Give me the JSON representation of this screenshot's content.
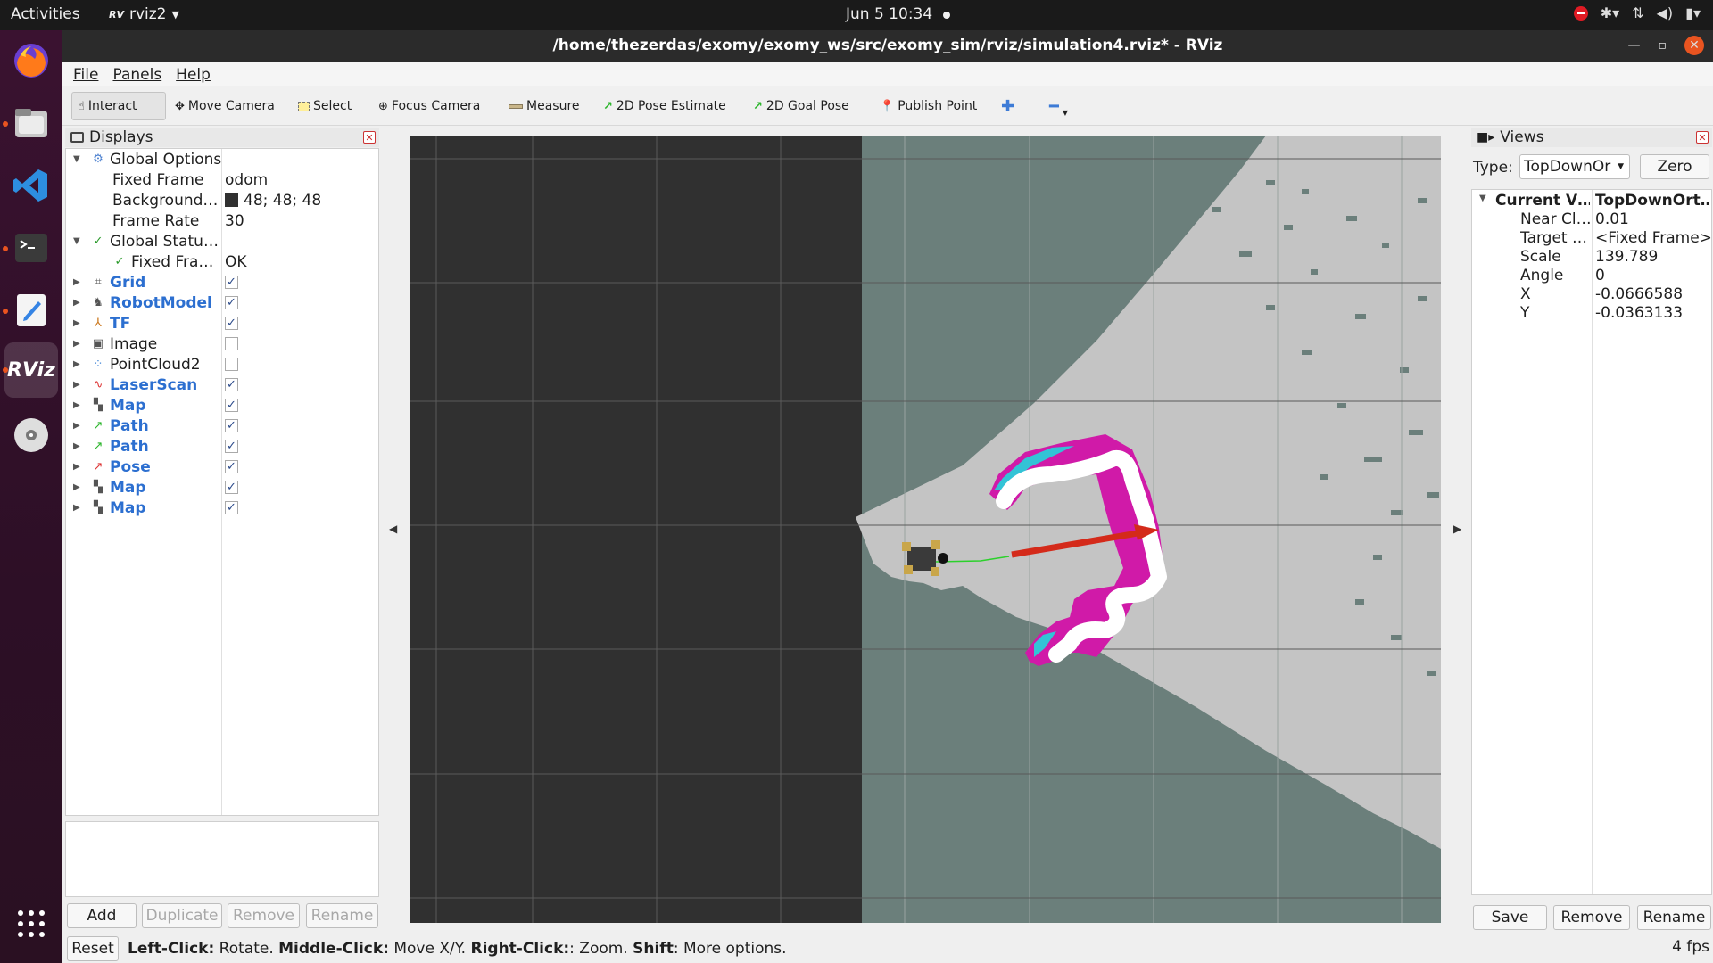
{
  "topbar": {
    "activities": "Activities",
    "app_name": "rviz2",
    "app_badge": "RV",
    "clock": "Jun 5  10:34"
  },
  "dock": {
    "items": [
      "firefox-icon",
      "files-icon",
      "vscode-icon",
      "terminal-icon",
      "text-editor-icon",
      "rviz-icon",
      "disc-icon",
      "app-grid-icon"
    ],
    "rviz_label": "RViz"
  },
  "window": {
    "title": "/home/thezerdas/exomy/exomy_ws/src/exomy_sim/rviz/simulation4.rviz* - RViz"
  },
  "menubar": [
    "File",
    "Panels",
    "Help"
  ],
  "toolbar": {
    "interact": "Interact",
    "move_camera": "Move Camera",
    "select": "Select",
    "focus_camera": "Focus Camera",
    "measure": "Measure",
    "pose_estimate": "2D Pose Estimate",
    "goal_pose": "2D Goal Pose",
    "publish_point": "Publish Point"
  },
  "displays": {
    "title": "Displays",
    "global_options": "Global Options",
    "fixed_frame_label": "Fixed Frame",
    "fixed_frame_value": "odom",
    "background_label": "Background…",
    "background_value": "48; 48; 48",
    "frame_rate_label": "Frame Rate",
    "frame_rate_value": "30",
    "global_status": "Global Statu…",
    "status_fixed_label": "Fixed Fra…",
    "status_fixed_value": "OK",
    "items": [
      {
        "name": "Grid",
        "checked": true
      },
      {
        "name": "RobotModel",
        "checked": true
      },
      {
        "name": "TF",
        "checked": true
      },
      {
        "name": "Image",
        "checked": false
      },
      {
        "name": "PointCloud2",
        "checked": false
      },
      {
        "name": "LaserScan",
        "checked": true
      },
      {
        "name": "Map",
        "checked": true
      },
      {
        "name": "Path",
        "checked": true
      },
      {
        "name": "Path",
        "checked": true
      },
      {
        "name": "Pose",
        "checked": true
      },
      {
        "name": "Map",
        "checked": true
      },
      {
        "name": "Map",
        "checked": true
      }
    ],
    "buttons": {
      "add": "Add",
      "duplicate": "Duplicate",
      "remove": "Remove",
      "rename": "Rename"
    }
  },
  "views": {
    "title": "Views",
    "type_label": "Type:",
    "type_value": "TopDownOr",
    "zero": "Zero",
    "current_label": "Current V…",
    "current_value": "TopDownOrt…",
    "properties": [
      {
        "key": "Near Cl…",
        "value": "0.01"
      },
      {
        "key": "Target …",
        "value": "<Fixed Frame>"
      },
      {
        "key": "Scale",
        "value": "139.789"
      },
      {
        "key": "Angle",
        "value": "0"
      },
      {
        "key": "X",
        "value": "-0.0666588"
      },
      {
        "key": "Y",
        "value": "-0.0363133"
      }
    ],
    "buttons": {
      "save": "Save",
      "remove": "Remove",
      "rename": "Rename"
    }
  },
  "statusbar": {
    "reset": "Reset",
    "left_key": "Left-Click:",
    "left_desc": " Rotate. ",
    "middle_key": "Middle-Click:",
    "middle_desc": " Move X/Y. ",
    "right_key": "Right-Click:",
    "right_desc": ": Zoom. ",
    "shift_key": "Shift",
    "shift_desc": ": More options.",
    "fps": "4 fps"
  },
  "colors": {
    "background": "#303030",
    "unknown_map": "#6b7f7b",
    "free_space": "#c4c4c4",
    "accent": "#e95420",
    "link_blue": "#2c6fd0"
  }
}
